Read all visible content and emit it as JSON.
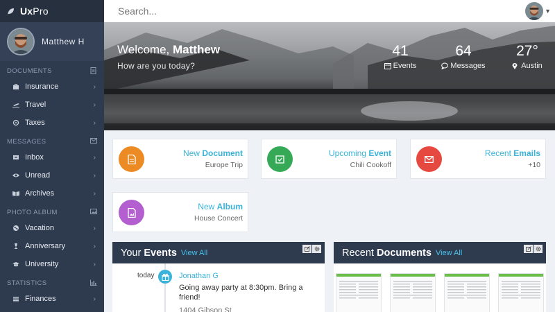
{
  "brand": {
    "bold": "Ux",
    "rest": "Pro"
  },
  "profile": {
    "name": "Matthew H"
  },
  "sidebar": {
    "sections": [
      {
        "title": "DOCUMENTS",
        "icon": "document-icon",
        "items": [
          {
            "label": "Insurance",
            "icon": "briefcase-icon"
          },
          {
            "label": "Travel",
            "icon": "plane-icon"
          },
          {
            "label": "Taxes",
            "icon": "coins-icon"
          }
        ]
      },
      {
        "title": "MESSAGES",
        "icon": "envelope-icon",
        "items": [
          {
            "label": "Inbox",
            "icon": "inbox-icon"
          },
          {
            "label": "Unread",
            "icon": "eye-icon"
          },
          {
            "label": "Archives",
            "icon": "book-icon"
          }
        ]
      },
      {
        "title": "PHOTO ALBUM",
        "icon": "image-icon",
        "items": [
          {
            "label": "Vacation",
            "icon": "globe-icon"
          },
          {
            "label": "Anniversary",
            "icon": "cocktail-icon"
          },
          {
            "label": "University",
            "icon": "graduation-cap-icon"
          }
        ]
      },
      {
        "title": "STATISTICS",
        "icon": "bar-chart-icon",
        "items": [
          {
            "label": "Finances",
            "icon": "list-icon"
          }
        ]
      }
    ]
  },
  "search": {
    "placeholder": "Search..."
  },
  "hero": {
    "welcome_prefix": "Welcome,",
    "welcome_name": "Matthew",
    "subtitle": "How are you today?",
    "stats": [
      {
        "value": "41",
        "label": "Events",
        "icon": "calendar-icon"
      },
      {
        "value": "64",
        "label": "Messages",
        "icon": "comment-icon"
      },
      {
        "value": "27°",
        "label": "Austin",
        "icon": "map-marker-icon"
      }
    ]
  },
  "cards": [
    {
      "light": "New",
      "bold": "Document",
      "detail": "Europe Trip",
      "color": "#ec8a24",
      "icon": "document-icon"
    },
    {
      "light": "Upcoming",
      "bold": "Event",
      "detail": "Chili Cookoff",
      "color": "#35a956",
      "icon": "calendar-check-icon"
    },
    {
      "light": "Recent",
      "bold": "Emails",
      "detail": "+10",
      "color": "#e6493f",
      "icon": "envelope-icon"
    },
    {
      "light": "New",
      "bold": "Album",
      "detail": "House Concert",
      "color": "#b45fcf",
      "icon": "image-file-icon"
    }
  ],
  "events_panel": {
    "title_light": "Your",
    "title_bold": "Events",
    "view_all": "View All",
    "item": {
      "date": "today",
      "name": "Jonathan G",
      "text": "Going away party at 8:30pm. Bring a friend!",
      "address": "1404 Gibson St",
      "icon": "gift-icon"
    }
  },
  "documents_panel": {
    "title_light": "Recent",
    "title_bold": "Documents",
    "view_all": "View All"
  },
  "colors": {
    "accent": "#3bb3d8",
    "sidebar": "#2e3a4e",
    "panel_head": "#2e3a4e",
    "doc_bar": "#6abf4b"
  }
}
